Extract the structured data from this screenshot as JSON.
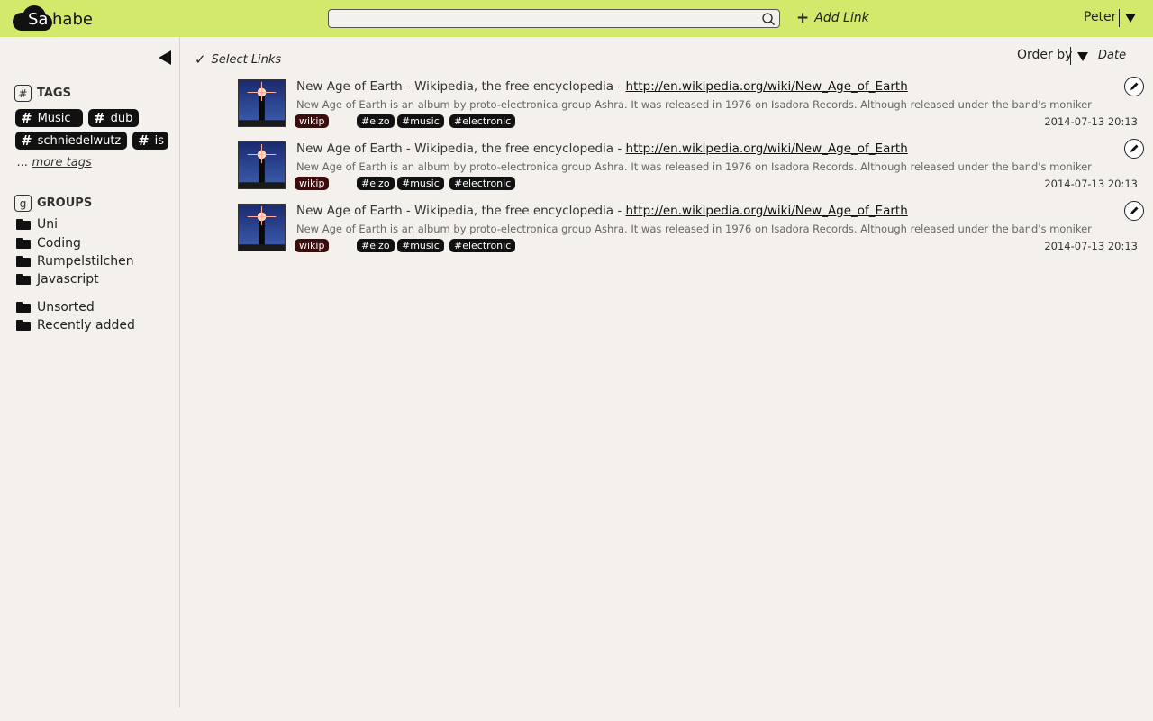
{
  "app": {
    "logo_prefix": "Sa",
    "logo_suffix": "habe",
    "search": {
      "value": "",
      "placeholder": ""
    },
    "add_link_label": "Add Link",
    "user_name": "Peter"
  },
  "sidebar": {
    "tags_title": "TAGS",
    "tags_icon": "#",
    "tags": [
      {
        "label": "Music"
      },
      {
        "label": "dub"
      },
      {
        "label": "schniedelwutz"
      },
      {
        "label": "is"
      }
    ],
    "more_prefix": "...",
    "more_label": "more tags",
    "groups_title": "GROUPS",
    "groups_icon": "g",
    "groups": [
      "Uni",
      "Coding",
      "Rumpelstilchen",
      "Javascript"
    ],
    "special_groups": [
      "Unsorted",
      "Recently added"
    ]
  },
  "main": {
    "select_links_label": "Select Links",
    "order_by_label": "Order by",
    "order_by_value": "Date",
    "links": [
      {
        "title": "New Age of Earth - Wikipedia, the free encyclopedia - ",
        "url": "http://en.wikipedia.org/wiki/New_Age_of_Earth",
        "description": "New Age of Earth is an album by proto-electronica group Ashra. It was released in 1976 on Isadora Records. Although released under the band's moniker, it is a solo",
        "source_tag": "wikip",
        "tags": [
          "#eizo",
          "#music",
          "#electronic"
        ],
        "date": "2014-07-13 20:13"
      },
      {
        "title": "New Age of Earth - Wikipedia, the free encyclopedia - ",
        "url": "http://en.wikipedia.org/wiki/New_Age_of_Earth",
        "description": "New Age of Earth is an album by proto-electronica group Ashra. It was released in 1976 on Isadora Records. Although released under the band's moniker, it is a solo",
        "source_tag": "wikip",
        "tags": [
          "#eizo",
          "#music",
          "#electronic"
        ],
        "date": "2014-07-13 20:13"
      },
      {
        "title": "New Age of Earth - Wikipedia, the free encyclopedia - ",
        "url": "http://en.wikipedia.org/wiki/New_Age_of_Earth",
        "description": "New Age of Earth is an album by proto-electronica group Ashra. It was released in 1976 on Isadora Records. Although released under the band's moniker, it is a solo",
        "source_tag": "wikip",
        "tags": [
          "#eizo",
          "#music",
          "#electronic"
        ],
        "date": "2014-07-13 20:13"
      }
    ]
  },
  "colors": {
    "header_bg": "#d2e96c",
    "page_bg": "#f4f1ed",
    "tag_bg": "#111111",
    "source_tag_bg": "#3c0d0d"
  },
  "icons": {
    "logo": "cloud-icon",
    "search": "search-icon",
    "add": "plus-icon",
    "user_menu": "caret-down-icon",
    "collapse": "triangle-left-icon",
    "select": "check-icon",
    "folder": "folder-icon",
    "edit": "pencil-icon"
  }
}
